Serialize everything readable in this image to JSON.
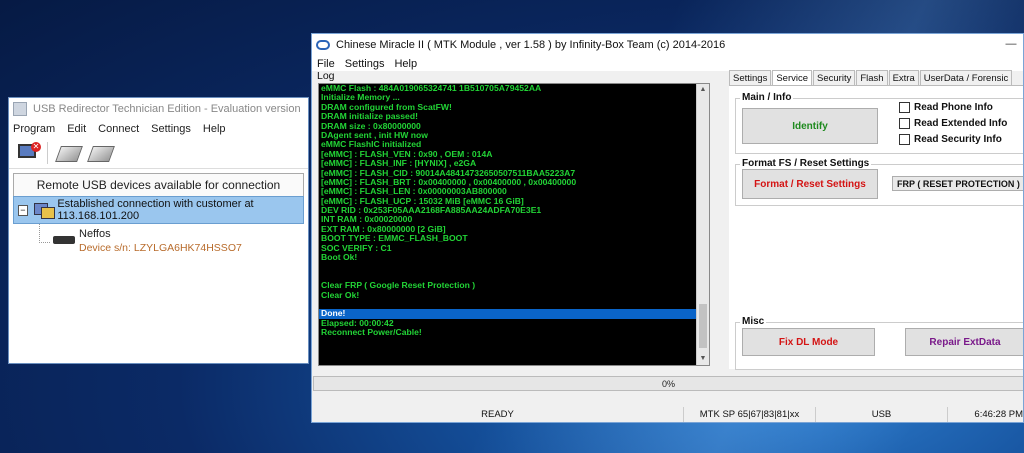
{
  "usb": {
    "title": "USB Redirector Technician Edition - Evaluation version",
    "menu": [
      "Program",
      "Edit",
      "Connect",
      "Settings",
      "Help"
    ],
    "header": "Remote USB devices available for connection",
    "connection": "Established connection with customer at 113.168.101.200",
    "device_name": "Neffos",
    "device_sn": "Device s/n: LZYLGA6HK74HSSO7"
  },
  "miracle": {
    "title": "Chinese Miracle II ( MTK Module , ver 1.58 ) by Infinity-Box Team (c) 2014-2016",
    "menu": [
      "File",
      "Settings",
      "Help"
    ],
    "log_label": "Log",
    "log_lines": [
      "eMMC Flash : 484A019065324741 1B510705A79452AA",
      "Initialize Memory ...",
      "DRAM configured from ScatFW!",
      "DRAM initialize passed!",
      "DRAM size : 0x80000000",
      "DAgent sent , init HW now",
      "eMMC FlashIC initialized",
      "[eMMC] : FLASH_VEN : 0x90 , OEM : 014A",
      "[eMMC] : FLASH_INF : [HYNIX] , e2GA",
      "[eMMC] : FLASH_CID : 90014A48414732650507511BAA5223A7",
      "[eMMC] : FLASH_BRT : 0x00400000 , 0x00400000 , 0x00400000",
      "[eMMC] : FLASH_LEN : 0x00000003AB800000",
      "[eMMC] : FLASH_UCP : 15032 MiB [eMMC 16 GiB]",
      "DEV RID    : 0x253F05AAA2168FA885AA24ADFA70E3E1",
      "INT RAM    : 0x00020000",
      "EXT RAM    : 0x80000000 [2 GiB]",
      "BOOT TYPE : EMMC_FLASH_BOOT",
      "SOC VERIFY : C1",
      "Boot Ok!",
      "",
      "",
      "Clear FRP ( Google Reset Protection )",
      "Clear Ok!",
      "",
      "Done!",
      "Elapsed: 00:00:42",
      "Reconnect Power/Cable!"
    ],
    "selected_line": 24,
    "tabs": [
      "Settings",
      "Service",
      "Security",
      "Flash",
      "Extra",
      "UserData / Forensic"
    ],
    "active_tab": "Service",
    "main_info_label": "Main / Info",
    "identify_label": "Identify",
    "checkboxes": [
      "Read Phone Info",
      "Read Extended Info",
      "Read Security Info"
    ],
    "format_label": "Format FS / Reset Settings",
    "format_button": "Format / Reset Settings",
    "format_combo": "FRP ( RESET PROTECTION )",
    "misc_label": "Misc",
    "fixdl_button": "Fix DL Mode",
    "repair_button": "Repair ExtData",
    "progress_text": "0%",
    "progress_value": 0,
    "status": {
      "ready": "READY",
      "port": "MTK SP 65|67|83|81|xx",
      "usb": "USB",
      "time": "6:46:28 PM"
    }
  }
}
